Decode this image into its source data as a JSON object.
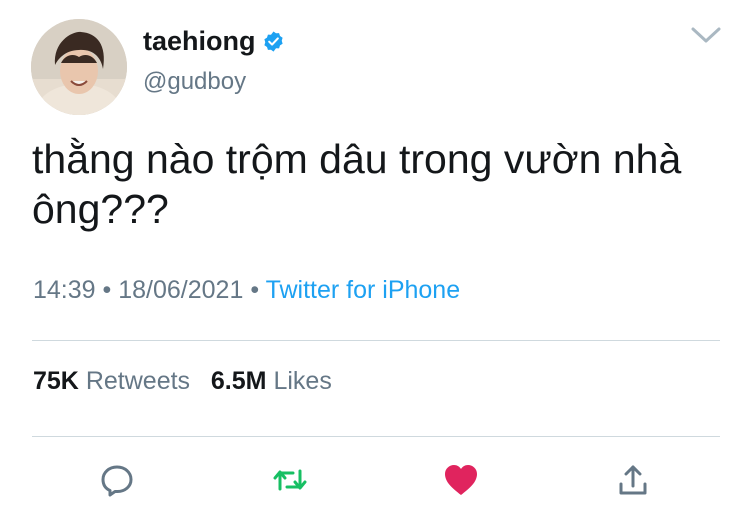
{
  "user": {
    "display_name": "taehiong",
    "handle": "@gudboy",
    "verified": true
  },
  "tweet": {
    "text_line1": "thằng nào trộm dâu trong vườn nhà",
    "text_line2": "ông???",
    "time": "14:39",
    "date": "18/06/2021",
    "separator": "•",
    "source": "Twitter for iPhone"
  },
  "stats": {
    "retweets_count": "75K",
    "retweets_label": "Retweets",
    "likes_count": "6.5M",
    "likes_label": "Likes"
  },
  "actions": [
    {
      "name": "reply",
      "icon": "reply-icon"
    },
    {
      "name": "retweet",
      "icon": "retweet-icon"
    },
    {
      "name": "like",
      "icon": "heart-icon"
    },
    {
      "name": "share",
      "icon": "share-icon"
    }
  ],
  "colors": {
    "link": "#1da1f2",
    "verified": "#1da1f2",
    "retweet": "#17bf63",
    "like": "#e0245e",
    "secondary_text": "#657786"
  }
}
